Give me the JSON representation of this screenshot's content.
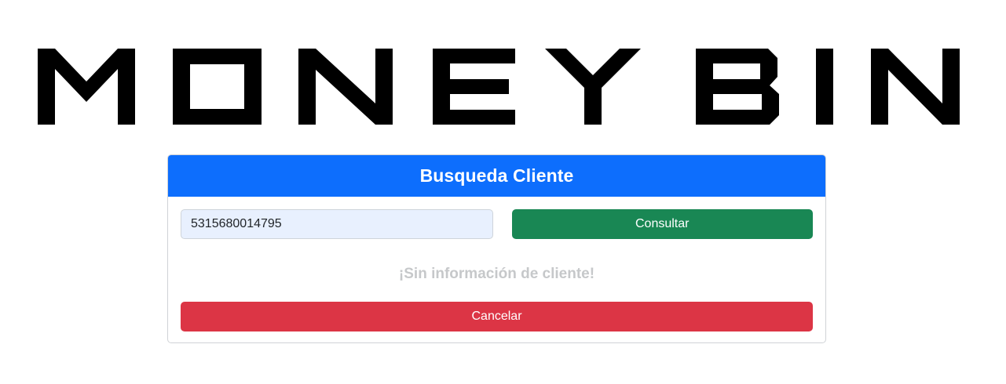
{
  "brand": {
    "logo_text": "MONEY BIN"
  },
  "card": {
    "title": "Busqueda Cliente",
    "search_value": "5315680014795",
    "consult_label": "Consultar",
    "empty_message": "¡Sin información de cliente!",
    "cancel_label": "Cancelar"
  },
  "colors": {
    "header": "#0d6efd",
    "consult_button": "#198754",
    "cancel_button": "#dc3545",
    "input_background": "#e8f0fe"
  }
}
